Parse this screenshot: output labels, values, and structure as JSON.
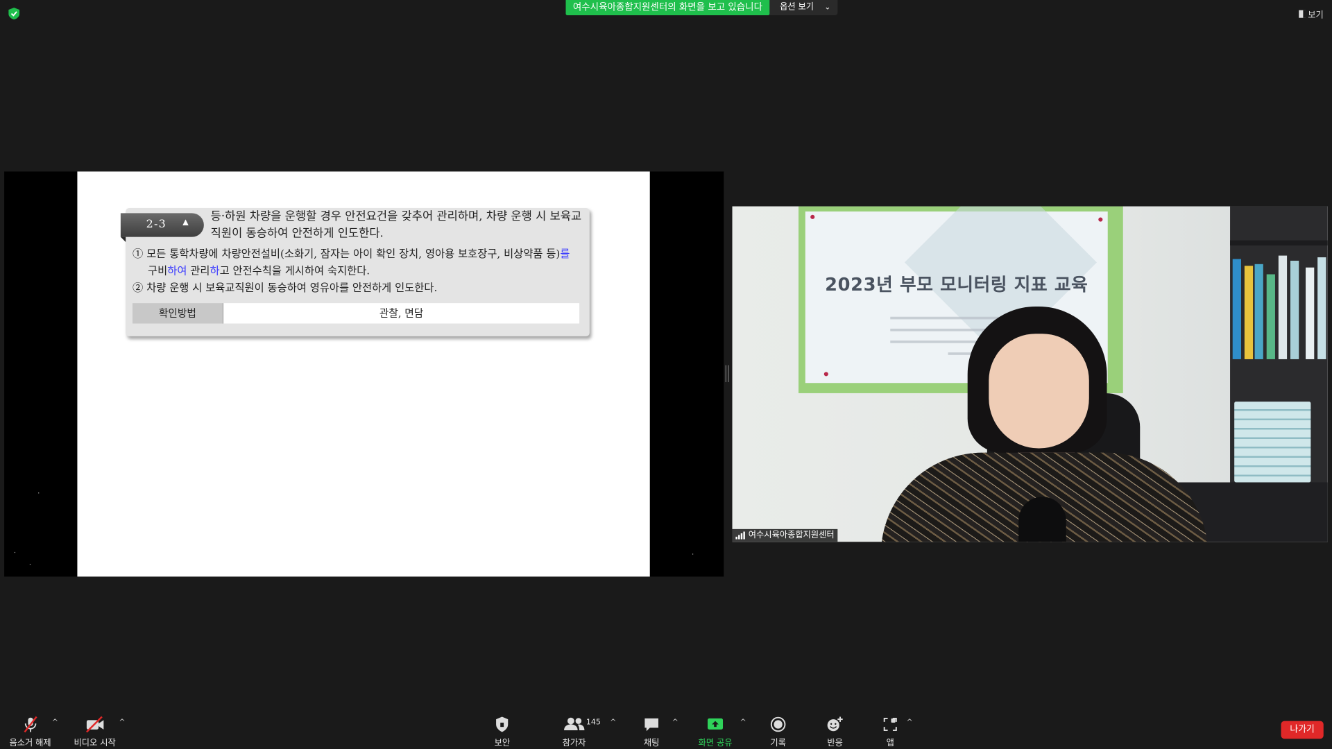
{
  "top_bar": {
    "share_banner": "여수시육아종합지원센터의 화면을 보고 있습니다",
    "view_options": "옵션 보기",
    "view_toggle": "보기"
  },
  "slide": {
    "tag": "2-3",
    "title": "등·하원 차량을 운행할 경우 안전요건을 갖추어 관리하며, 차량 운행 시 보육교직원이 동승하여 안전하게 인도한다.",
    "item1_a": "① 모든 통학차량에 차량안전설비(소화기, 잠자는 아이 확인 장치, 영아용 보호장구, 비상약품 등)",
    "item1_b": "를",
    "item1_c": "구비",
    "item1_d": "하여",
    "item1_e": " 관리",
    "item1_f": "하",
    "item1_g": "고 안전수칙을 게시하여 숙지한다.",
    "item2": "② 차량 운행 시 보육교직원이 동승하여 영유아를 안전하게 인도한다.",
    "check_label": "확인방법",
    "check_value": "관찰, 면담"
  },
  "video": {
    "banner_title": "2023년 부모 모니터링 지표 교육",
    "participant_name": "여수시육아종합지원센터"
  },
  "toolbar": {
    "mute": "음소거 해제",
    "video": "비디오 시작",
    "security": "보안",
    "participants": "참가자",
    "participants_count": "145",
    "chat": "채팅",
    "share": "화면 공유",
    "record": "기록",
    "reactions": "반응",
    "apps": "앱",
    "leave": "나가기"
  },
  "colors": {
    "share_green": "#1fbf4c",
    "leave_red": "#e02828",
    "banner_frame": "#9ad07a",
    "highlight_blue": "#3a3aff"
  }
}
